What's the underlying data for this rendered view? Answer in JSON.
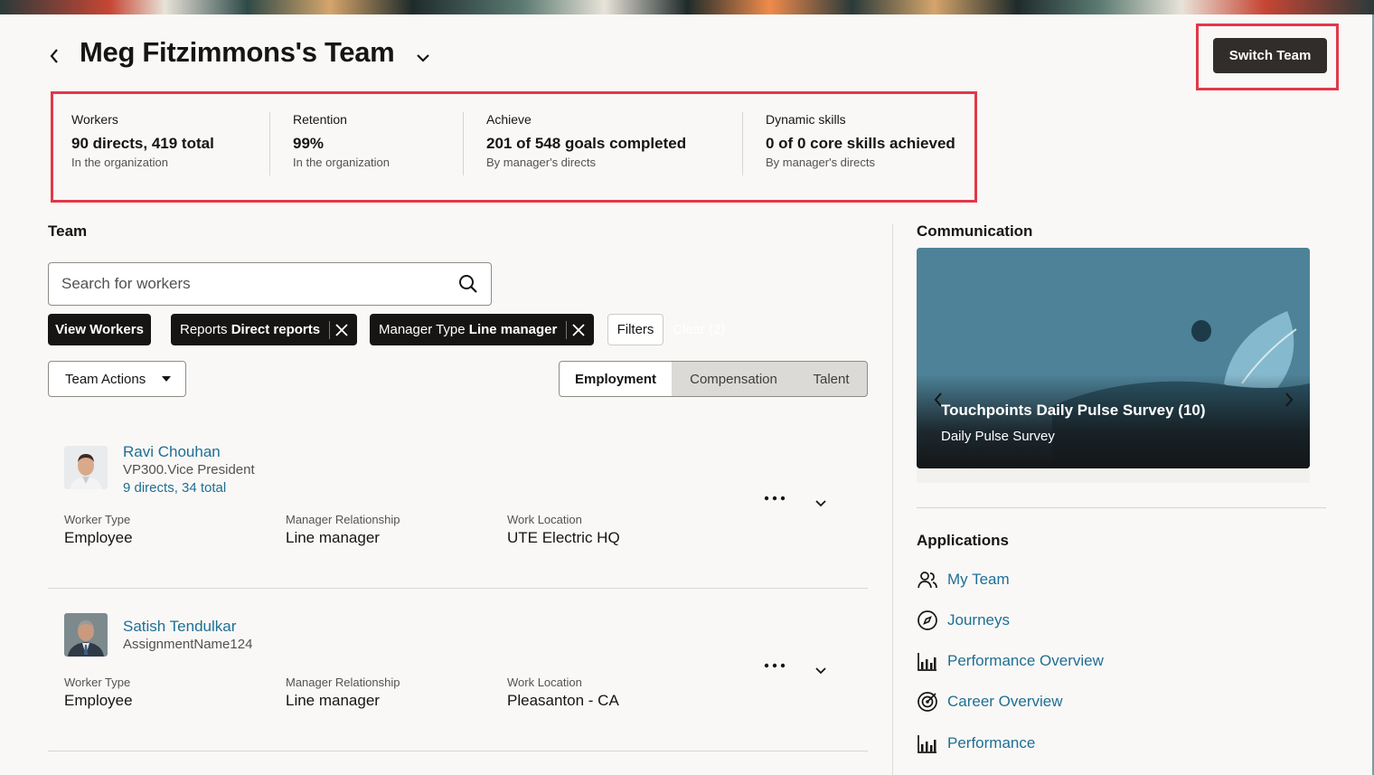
{
  "header": {
    "title": "Meg Fitzimmons's Team",
    "switch_team_label": "Switch Team"
  },
  "metrics": [
    {
      "label": "Workers",
      "value": "90 directs, 419 total",
      "sub": "In the organization"
    },
    {
      "label": "Retention",
      "value": "99%",
      "sub": "In the organization"
    },
    {
      "label": "Achieve",
      "value": "201 of 548 goals completed",
      "sub": "By manager's directs"
    },
    {
      "label": "Dynamic skills",
      "value": "0 of 0 core skills achieved",
      "sub": "By manager's directs"
    }
  ],
  "team": {
    "heading": "Team",
    "search_placeholder": "Search for workers",
    "chips": {
      "view_workers": "View Workers",
      "reports_prefix": "Reports",
      "reports_value": "Direct reports",
      "manager_prefix": "Manager Type",
      "manager_value": "Line manager"
    },
    "filters_label": "Filters",
    "clear_label": "Clear (2)",
    "team_actions_label": "Team Actions",
    "tabs": [
      "Employment",
      "Compensation",
      "Talent"
    ],
    "field_labels": {
      "worker_type": "Worker Type",
      "manager_relationship": "Manager Relationship",
      "work_location": "Work Location"
    },
    "workers": [
      {
        "name": "Ravi Chouhan",
        "assignment": "VP300.Vice President",
        "directs": "9 directs, 34 total",
        "worker_type": "Employee",
        "manager_relationship": "Line manager",
        "work_location": "UTE Electric HQ"
      },
      {
        "name": "Satish Tendulkar",
        "assignment": "AssignmentName124",
        "worker_type": "Employee",
        "manager_relationship": "Line manager",
        "work_location": "Pleasanton - CA"
      }
    ]
  },
  "communication": {
    "heading": "Communication",
    "card_title": "Touchpoints Daily Pulse Survey (10)",
    "card_subtitle": "Daily Pulse Survey"
  },
  "applications": {
    "heading": "Applications",
    "items": [
      {
        "label": "My Team",
        "icon": "people-icon"
      },
      {
        "label": "Journeys",
        "icon": "compass-icon"
      },
      {
        "label": "Performance Overview",
        "icon": "bar-chart-icon"
      },
      {
        "label": "Career Overview",
        "icon": "target-icon"
      },
      {
        "label": "Performance",
        "icon": "bar-chart-icon"
      }
    ]
  },
  "colors": {
    "accent_link": "#1f6f94",
    "highlight_border": "#e0394a",
    "dark_button": "#312d2a"
  }
}
